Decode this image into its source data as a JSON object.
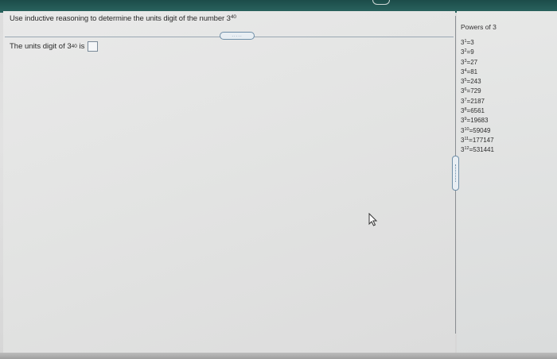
{
  "question": {
    "text": "Use inductive reasoning to determine the units digit of the number 3",
    "exponent": "40"
  },
  "answer": {
    "prefix": "The units digit of 3",
    "exponent": "40",
    "suffix": " is",
    "value": ""
  },
  "handle": {
    "label": "....."
  },
  "sidebar": {
    "title": "Powers of 3",
    "powers": [
      {
        "exp": "1",
        "value": "=3"
      },
      {
        "exp": "2",
        "value": "=9"
      },
      {
        "exp": "3",
        "value": "=27"
      },
      {
        "exp": "4",
        "value": "=81"
      },
      {
        "exp": "5",
        "value": "=243"
      },
      {
        "exp": "6",
        "value": "=729"
      },
      {
        "exp": "7",
        "value": "=2187"
      },
      {
        "exp": "8",
        "value": "=6561"
      },
      {
        "exp": "9",
        "value": "=19683"
      },
      {
        "exp": "10",
        "value": "=59049"
      },
      {
        "exp": "11",
        "value": "=177147"
      },
      {
        "exp": "12",
        "value": "=531441"
      }
    ]
  },
  "icons": {
    "cursor": "mouse-pointer-icon",
    "scroll": "scroll-thumb-icon"
  },
  "colors": {
    "top_bar": "#1c4c49",
    "accent": "#6f8fa8"
  }
}
